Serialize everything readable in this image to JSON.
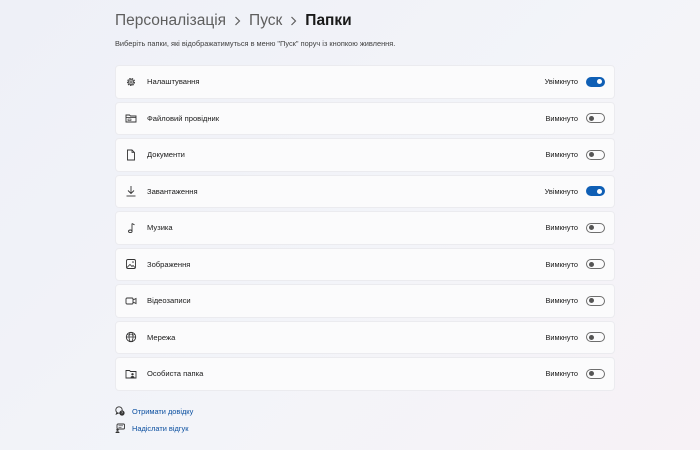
{
  "breadcrumb": {
    "items": [
      "Персоналізація",
      "Пуск",
      "Папки"
    ],
    "separator_icon": "chevron-right-icon"
  },
  "description": "Виберіть папки, які відображатимуться в меню \"Пуск\" поруч із кнопкою живлення.",
  "folders": [
    {
      "label": "Налаштування",
      "icon": "gear-icon",
      "state": "Увімкнуто",
      "on": true
    },
    {
      "label": "Файловий провідник",
      "icon": "file-explorer-icon",
      "state": "Вимкнуто",
      "on": false
    },
    {
      "label": "Документи",
      "icon": "document-icon",
      "state": "Вимкнуто",
      "on": false
    },
    {
      "label": "Завантаження",
      "icon": "download-icon",
      "state": "Увімкнуто",
      "on": true
    },
    {
      "label": "Музика",
      "icon": "music-note-icon",
      "state": "Вимкнуто",
      "on": false
    },
    {
      "label": "Зображення",
      "icon": "image-icon",
      "state": "Вимкнуто",
      "on": false
    },
    {
      "label": "Відеозаписи",
      "icon": "video-icon",
      "state": "Вимкнуто",
      "on": false
    },
    {
      "label": "Мережа",
      "icon": "network-globe-icon",
      "state": "Вимкнуто",
      "on": false
    },
    {
      "label": "Особиста папка",
      "icon": "personal-folder-icon",
      "state": "Вимкнуто",
      "on": false
    }
  ],
  "links": [
    {
      "label": "Отримати довідку",
      "icon": "help-icon"
    },
    {
      "label": "Надіслати відгук",
      "icon": "feedback-icon"
    }
  ],
  "colors": {
    "accent": "#0f5fb5",
    "link": "#0a4fa0"
  }
}
